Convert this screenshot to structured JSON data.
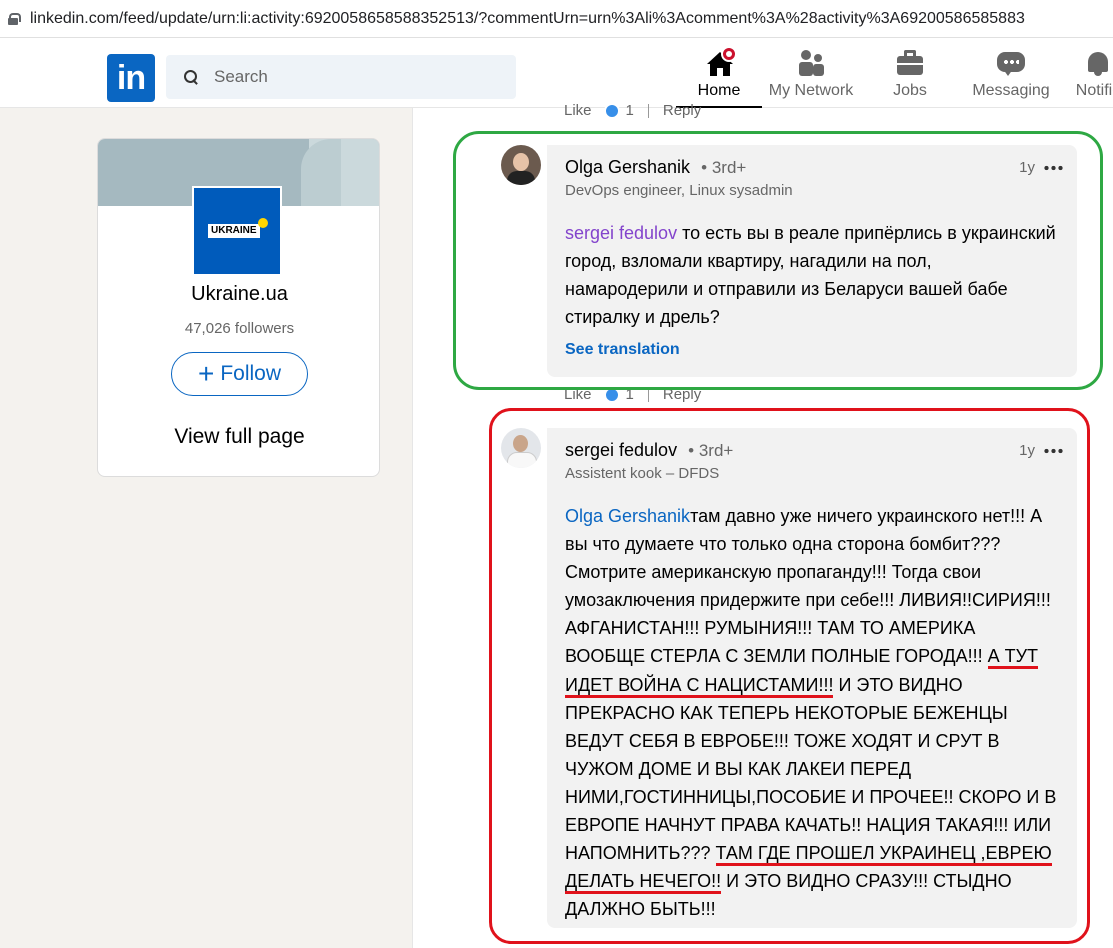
{
  "browser": {
    "url": "linkedin.com/feed/update/urn:li:activity:6920058658588352513/?commentUrn=urn%3Ali%3Acomment%3A%28activity%3A69200586585883"
  },
  "header": {
    "logo": "in",
    "search_placeholder": "Search",
    "nav": {
      "home": "Home",
      "network": "My Network",
      "jobs": "Jobs",
      "messaging": "Messaging",
      "notifications": "Notific"
    }
  },
  "org_card": {
    "logo_text": "UKRAINE",
    "name": "Ukraine.ua",
    "followers": "47,026 followers",
    "follow_label": "Follow",
    "view_full": "View full page"
  },
  "comments": [
    {
      "author": "Olga Gershanik",
      "degree": "• 3rd+",
      "headline": "DevOps engineer, Linux sysadmin",
      "time": "1y",
      "mention": "sergei fedulov",
      "text": " то есть вы в реале припёрлись в украинский город, взломали квартиру, нагадили на пол, намародерили и отправили из Беларуси вашей бабе стиралку и дрель?",
      "see_translation": "See translation"
    },
    {
      "author": "sergei fedulov",
      "degree": "• 3rd+",
      "headline": "Assistent kook – DFDS",
      "time": "1y",
      "mention": "Olga Gershanik",
      "text_part1": "там давно уже ничего украинского нет!!! А вы что думаете что только одна сторона бомбит??? Смотрите американскую пропаганду!!! Тогда свои умозаключения придержите при себе!!! ЛИВИЯ!!СИРИЯ!!! АФГАНИСТАН!!! РУМЫНИЯ!!! ТАМ ТО АМЕРИКА ВООБЩЕ СТЕРЛА С ЗЕМЛИ ПОЛНЫЕ ГОРОДА!!! ",
      "highlight1": "А ТУТ ИДЕТ ВОЙНА С НАЦИСТАМИ!!!",
      "text_part2": " И ЭТО ВИДНО ПРЕКРАСНО КАК ТЕПЕРЬ НЕКОТОРЫЕ БЕЖЕНЦЫ ВЕДУТ СЕБЯ В ЕВРОБЕ!!! ТОЖЕ ХОДЯТ И СРУТ В ЧУЖОМ ДОМЕ И ВЫ КАК ЛАКЕИ ПЕРЕД НИМИ,ГОСТИННИЦЫ,ПОСОБИЕ И ПРОЧЕЕ!! СКОРО И В ЕВРОПЕ НАЧНУТ ПРАВА КАЧАТЬ!! НАЦИЯ ТАКАЯ!!! ИЛИ НАПОМНИТЬ??? ",
      "highlight2": "ТАМ ГДЕ ПРОШЕЛ УКРАИНЕЦ ,ЕВРЕЮ ДЕЛАТЬ НЕЧЕГО!!",
      "text_part3": " И ЭТО ВИДНО СРАЗУ!!! СТЫДНО ДАЛЖНО БЫТЬ!!!"
    }
  ],
  "actions": {
    "like": "Like",
    "count": "1",
    "reply": "Reply"
  },
  "colors": {
    "linkedin_blue": "#0a66c2",
    "annotation_green": "#2ea843",
    "annotation_red": "#e0121b"
  }
}
